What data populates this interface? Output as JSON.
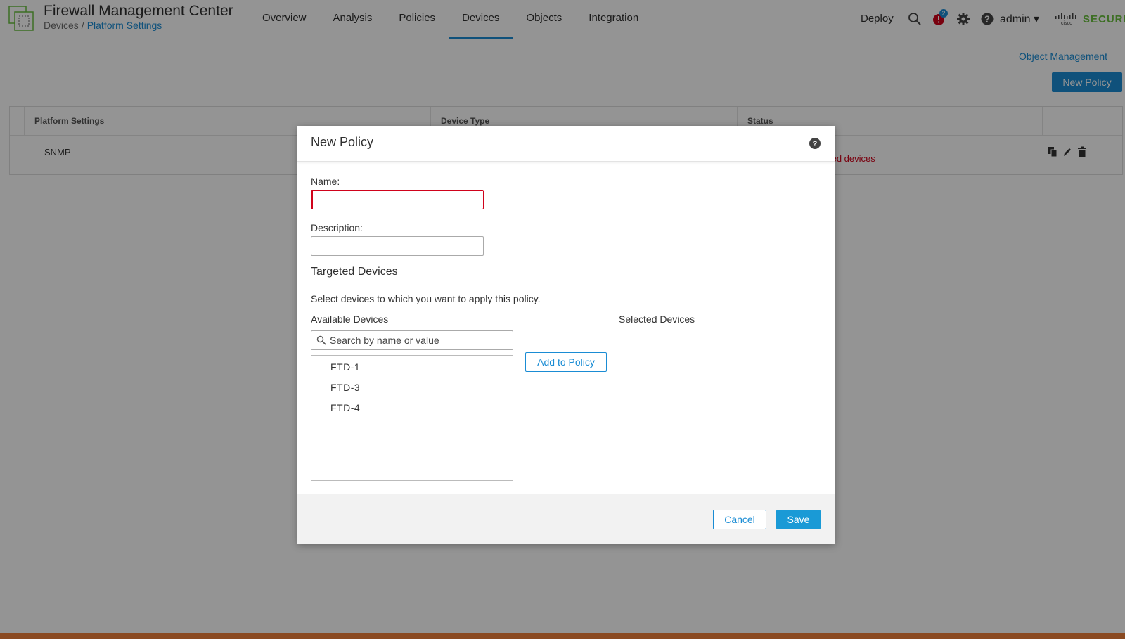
{
  "header": {
    "app_title": "Firewall Management Center",
    "breadcrumb": {
      "root": "Devices",
      "separator": "/",
      "current": "Platform Settings"
    },
    "nav": [
      "Overview",
      "Analysis",
      "Policies",
      "Devices",
      "Objects",
      "Integration"
    ],
    "active_nav": "Devices",
    "deploy_label": "Deploy",
    "alert_count": "2",
    "user_label": "admin ▾",
    "brand_text": "SECURE"
  },
  "page": {
    "object_management_link": "Object Management",
    "new_policy_button": "New Policy",
    "table": {
      "columns": [
        "Platform Settings",
        "Device Type",
        "Status"
      ],
      "rows": [
        {
          "name": "SNMP",
          "status_partial": "ted devices"
        }
      ]
    }
  },
  "modal": {
    "title": "New Policy",
    "name_label": "Name:",
    "name_value": "",
    "description_label": "Description:",
    "description_value": "",
    "targeted_devices_title": "Targeted Devices",
    "instructions": "Select devices to which you want to apply this policy.",
    "available_devices_label": "Available Devices",
    "search_placeholder": "Search by name or value",
    "available_devices": [
      "FTD-1",
      "FTD-3",
      "FTD-4"
    ],
    "add_to_policy_button": "Add to Policy",
    "selected_devices_label": "Selected Devices",
    "selected_devices": [],
    "cancel_button": "Cancel",
    "save_button": "Save"
  },
  "colors": {
    "accent": "#1a8cd4",
    "error": "#d0021b",
    "brand_green": "#6abf3f",
    "alert_red": "#d0021b"
  }
}
